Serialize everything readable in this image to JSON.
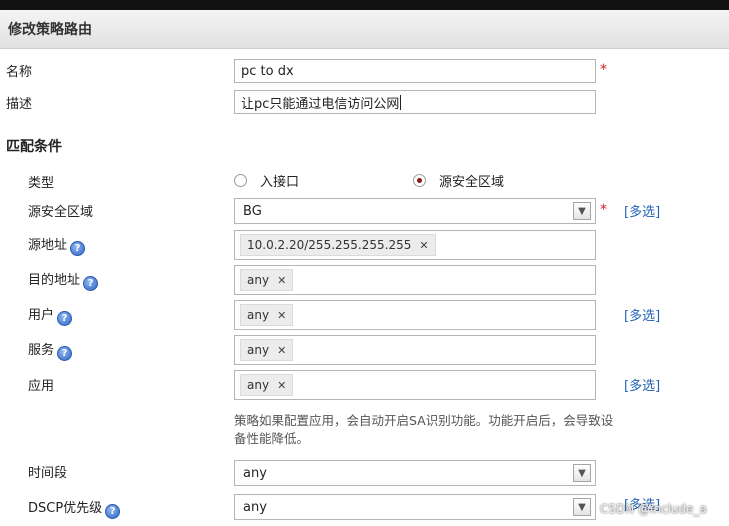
{
  "header": {
    "title": "修改策略路由"
  },
  "fields": {
    "name": {
      "label": "名称",
      "value": "pc to dx"
    },
    "description": {
      "label": "描述",
      "value": "让pc只能通过电信访问公网"
    }
  },
  "match": {
    "section_title": "匹配条件",
    "type": {
      "label": "类型",
      "options": [
        "入接口",
        "源安全区域"
      ],
      "selected": "源安全区域"
    },
    "source_zone": {
      "label": "源安全区域",
      "value": "BG",
      "multi": "[多选]"
    },
    "source_address": {
      "label": "源地址",
      "tags": [
        "10.0.2.20/255.255.255.255"
      ]
    },
    "dest_address": {
      "label": "目的地址",
      "tags": [
        "any"
      ]
    },
    "user": {
      "label": "用户",
      "tags": [
        "any"
      ],
      "multi": "[多选]"
    },
    "service": {
      "label": "服务",
      "tags": [
        "any"
      ]
    },
    "application": {
      "label": "应用",
      "tags": [
        "any"
      ],
      "multi": "[多选]"
    },
    "app_hint": "策略如果配置应用，会自动开启SA识别功能。功能开启后，会导致设备性能降低。",
    "time_range": {
      "label": "时间段",
      "value": "any"
    },
    "dscp": {
      "label": "DSCP优先级",
      "value": "any",
      "multi": "[多选]"
    }
  },
  "icons": {
    "help": "help-icon",
    "remove": "remove-tag-icon",
    "dropdown": "chevron-down-icon"
  },
  "watermark": "CSDN @include_a"
}
